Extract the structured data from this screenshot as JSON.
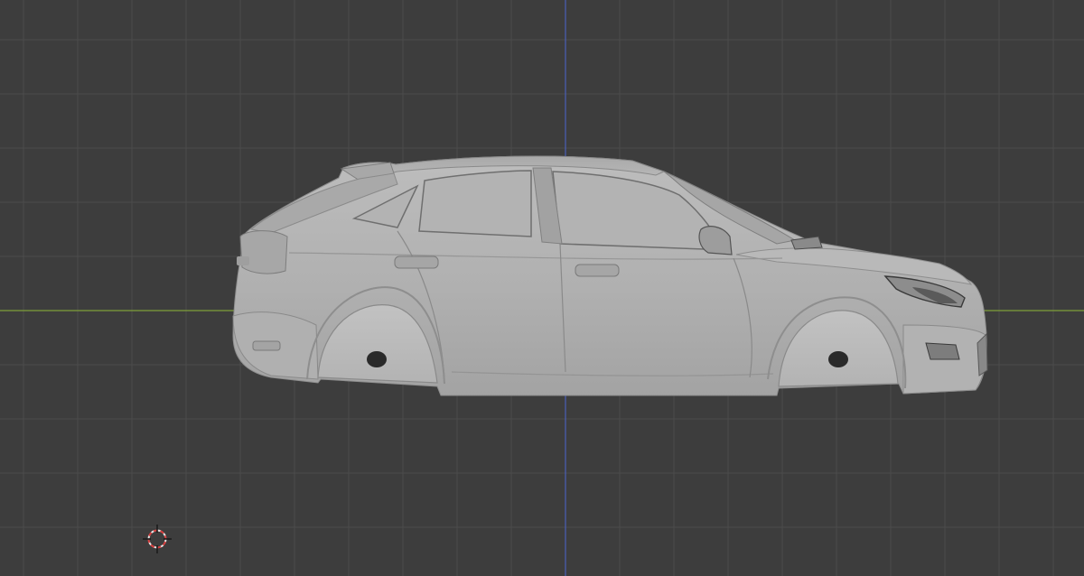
{
  "viewport": {
    "background_color": "#3d3d3d",
    "grid_minor_color": "#474747",
    "grid_major_color": "#4b4b4b",
    "x_axis_color": "#7f9f3a",
    "z_axis_color": "#4a5fb8",
    "model_base_color": "#b4b4b4",
    "model_shadow_color": "#9a9a9a",
    "model_dark_color": "#2a2a2a"
  },
  "scene": {
    "object": "car-mesh",
    "view": "side-orthographic"
  },
  "icons": {
    "cursor": "3d-cursor-icon"
  }
}
